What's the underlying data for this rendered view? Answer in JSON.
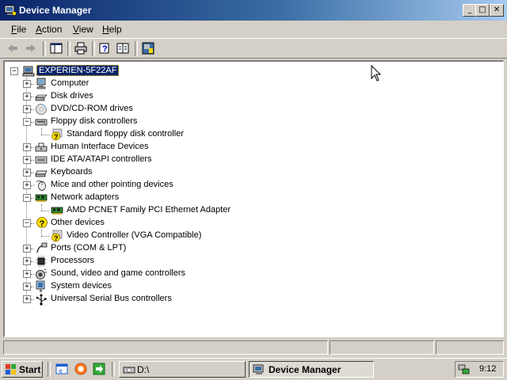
{
  "window": {
    "title": "Device Manager",
    "controls": {
      "minimize": "_",
      "maximize": "□",
      "close": "✕"
    }
  },
  "menu": [
    {
      "pre": "",
      "ul": "F",
      "post": "ile"
    },
    {
      "pre": "",
      "ul": "A",
      "post": "ction"
    },
    {
      "pre": "",
      "ul": "V",
      "post": "iew"
    },
    {
      "pre": "",
      "ul": "H",
      "post": "elp"
    }
  ],
  "toolbar_icons": [
    "back-arrow-icon",
    "forward-arrow-icon",
    "show-hide-console-tree-icon",
    "print-icon",
    "help-icon",
    "properties-icon",
    "scan-hardware-icon"
  ],
  "tree": {
    "root": "EXPERIEN-5F22AF",
    "items": [
      {
        "label": "Computer",
        "expanded": false,
        "icon": "computer-icon"
      },
      {
        "label": "Disk drives",
        "expanded": false,
        "icon": "disk-drive-icon"
      },
      {
        "label": "DVD/CD-ROM drives",
        "expanded": false,
        "icon": "cdrom-icon"
      },
      {
        "label": "Floppy disk controllers",
        "expanded": true,
        "icon": "floppy-controller-icon",
        "children": [
          {
            "label": "Standard floppy disk controller",
            "icon": "warning-device-icon"
          }
        ]
      },
      {
        "label": "Human Interface Devices",
        "expanded": false,
        "icon": "hid-icon"
      },
      {
        "label": "IDE ATA/ATAPI controllers",
        "expanded": false,
        "icon": "ide-controller-icon"
      },
      {
        "label": "Keyboards",
        "expanded": false,
        "icon": "keyboard-icon"
      },
      {
        "label": "Mice and other pointing devices",
        "expanded": false,
        "icon": "mouse-icon"
      },
      {
        "label": "Network adapters",
        "expanded": true,
        "icon": "network-adapter-icon",
        "children": [
          {
            "label": "AMD PCNET Family PCI Ethernet Adapter",
            "icon": "network-card-icon"
          }
        ]
      },
      {
        "label": "Other devices",
        "expanded": true,
        "icon": "unknown-device-icon",
        "children": [
          {
            "label": "Video Controller (VGA Compatible)",
            "icon": "warning-device-icon"
          }
        ]
      },
      {
        "label": "Ports (COM & LPT)",
        "expanded": false,
        "icon": "port-icon"
      },
      {
        "label": "Processors",
        "expanded": false,
        "icon": "processor-icon"
      },
      {
        "label": "Sound, video and game controllers",
        "expanded": false,
        "icon": "sound-icon"
      },
      {
        "label": "System devices",
        "expanded": false,
        "icon": "system-devices-icon"
      },
      {
        "label": "Universal Serial Bus controllers",
        "expanded": false,
        "icon": "usb-icon"
      }
    ]
  },
  "taskbar": {
    "start_label": "Start",
    "quicklaunch_icons": [
      "explorer-icon",
      "browser-icon",
      "desktop-icon"
    ],
    "tasks": [
      {
        "label": "D:\\",
        "active": false,
        "icon": "drive-icon"
      },
      {
        "label": "Device Manager",
        "active": true,
        "icon": "device-manager-icon"
      }
    ],
    "clock": "9:12"
  },
  "colors": {
    "title_active": "#0a246a",
    "title_gradient_end": "#a6caf0",
    "face": "#d4d0c8",
    "selection": "#0a246a",
    "warning": "#ffe000"
  }
}
